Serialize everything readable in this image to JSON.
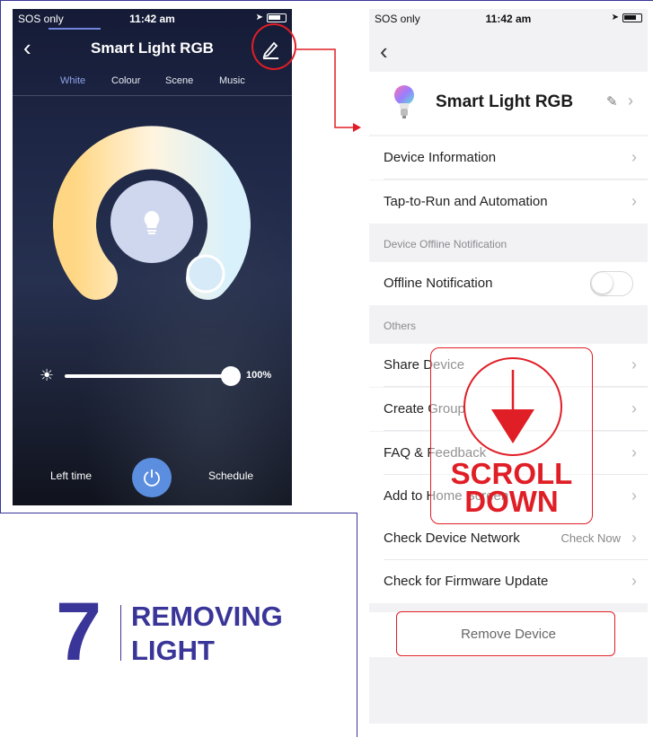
{
  "left_phone": {
    "status": {
      "carrier": "SOS only",
      "time": "11:42 am"
    },
    "title": "Smart Light RGB",
    "tabs": [
      {
        "label": "White",
        "active": true
      },
      {
        "label": "Colour",
        "active": false
      },
      {
        "label": "Scene",
        "active": false
      },
      {
        "label": "Music",
        "active": false
      }
    ],
    "brightness": {
      "value_label": "100%",
      "level_percent": 100
    },
    "bottom": {
      "left_time": "Left time",
      "schedule": "Schedule"
    },
    "colors": {
      "accent": "#5c8ee0",
      "tab_active": "#8fa3e8"
    }
  },
  "step": {
    "number": "7",
    "title_line1": "REMOVING",
    "title_line2": "LIGHT",
    "color": "#3a3598"
  },
  "right_phone": {
    "status": {
      "carrier": "SOS only",
      "time": "11:42 am"
    },
    "device_name": "Smart Light RGB",
    "rows": [
      {
        "label": "Device Information"
      },
      {
        "label": "Tap-to-Run and Automation"
      }
    ],
    "section_offline": "Device Offline Notification",
    "offline_row": {
      "label": "Offline Notification",
      "enabled": false
    },
    "section_others": "Others",
    "others_rows": [
      {
        "label": "Share Device"
      },
      {
        "label": "Create Group"
      },
      {
        "label": "FAQ & Feedback"
      },
      {
        "label": "Add to Home Screen"
      },
      {
        "label": "Check Device Network",
        "value": "Check Now"
      },
      {
        "label": "Check for Firmware Update"
      }
    ],
    "remove_label": "Remove Device"
  },
  "overlay": {
    "scroll_line1": "SCROLL",
    "scroll_line2": "DOWN",
    "highlight_color": "#e01e26"
  }
}
